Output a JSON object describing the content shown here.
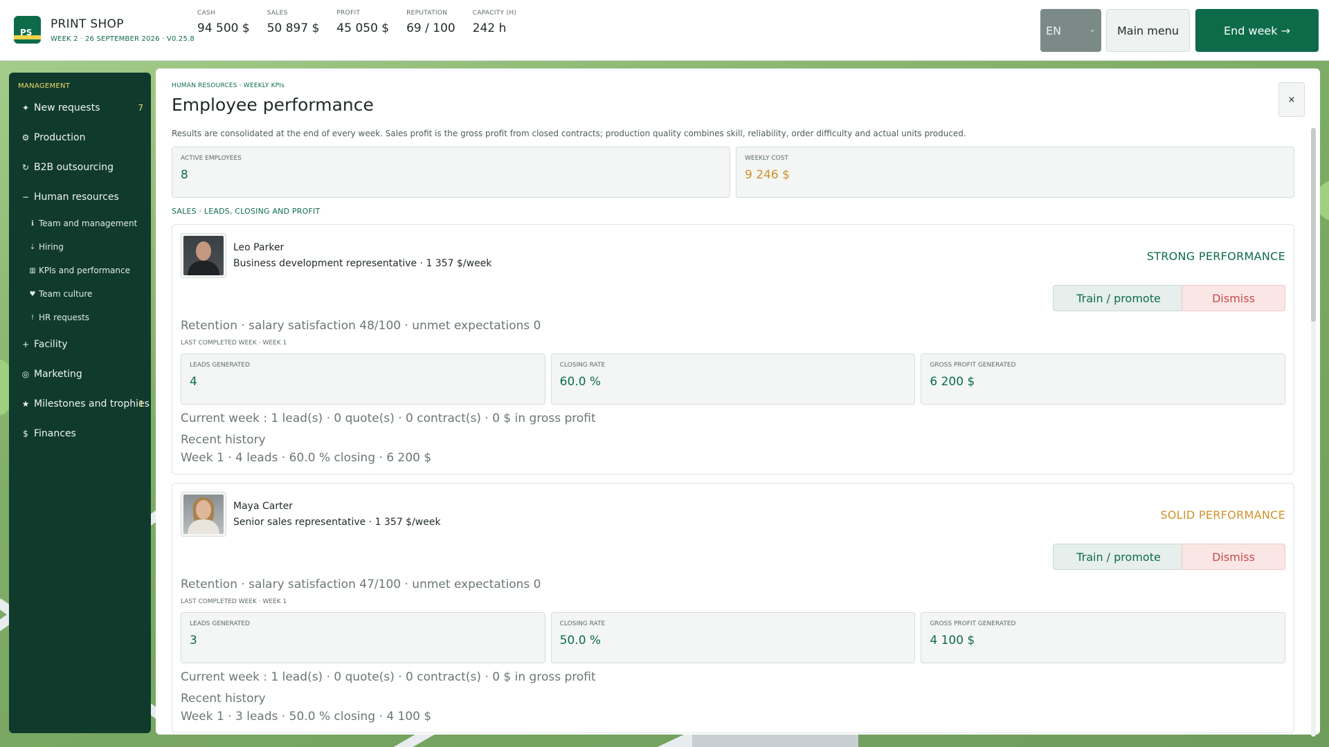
{
  "app": {
    "logo_text": "PS",
    "name": "PRINT SHOP",
    "subtitle": "WEEK 2 · 26 SEPTEMBER 2026 · V0.25.8"
  },
  "stats": [
    {
      "label": "CASH",
      "value": "94 500 $"
    },
    {
      "label": "SALES",
      "value": "50 897 $"
    },
    {
      "label": "PROFIT",
      "value": "45 050 $"
    },
    {
      "label": "REPUTATION",
      "value": "69 / 100"
    },
    {
      "label": "CAPACITY (H)",
      "value": "242 h"
    }
  ],
  "header_buttons": {
    "language": "EN",
    "main_menu": "Main menu",
    "end_week": "End week →"
  },
  "sidebar": {
    "section": "MANAGEMENT",
    "items": [
      {
        "icon": "✦",
        "label": "New requests",
        "badge": "7"
      },
      {
        "icon": "⚙",
        "label": "Production",
        "badge": ""
      },
      {
        "icon": "↻",
        "label": "B2B outsourcing",
        "badge": ""
      },
      {
        "icon": "−",
        "label": "Human resources",
        "badge": ""
      }
    ],
    "subitems": [
      {
        "icon": "ℹ",
        "label": "Team and management"
      },
      {
        "icon": "⇣",
        "label": "Hiring"
      },
      {
        "icon": "▥",
        "label": "KPIs and performance"
      },
      {
        "icon": "♥",
        "label": "Team culture"
      },
      {
        "icon": "!",
        "label": "HR requests"
      }
    ],
    "items_after": [
      {
        "icon": "+",
        "label": "Facility",
        "badge": ""
      },
      {
        "icon": "◎",
        "label": "Marketing",
        "badge": ""
      },
      {
        "icon": "★",
        "label": "Milestones and trophies",
        "badge": "1"
      },
      {
        "icon": "$",
        "label": "Finances",
        "badge": ""
      }
    ]
  },
  "panel": {
    "breadcrumb": "HUMAN RESOURCES · WEEKLY KPIs",
    "title": "Employee performance",
    "close": "×",
    "description": "Results are consolidated at the end of every week. Sales profit is the gross profit from closed contracts; production quality combines skill, reliability, order difficulty and actual units produced.",
    "summary": [
      {
        "label": "ACTIVE EMPLOYEES",
        "value": "8"
      },
      {
        "label": "WEEKLY COST",
        "value": "9 246 $"
      }
    ],
    "section_title": "SALES · LEADS, CLOSING AND PROFIT"
  },
  "employees": [
    {
      "name": "Leo Parker",
      "role": "Business development representative · 1 357 $/week",
      "performance": "STRONG PERFORMANCE",
      "train_label": "Train / promote",
      "dismiss_label": "Dismiss",
      "retention": "Retention · salary satisfaction 48/100 · unmet expectations 0",
      "last_week": "LAST COMPLETED WEEK · WEEK 1",
      "metrics": [
        {
          "label": "LEADS GENERATED",
          "value": "4"
        },
        {
          "label": "CLOSING RATE",
          "value": "60.0 %"
        },
        {
          "label": "GROSS PROFIT GENERATED",
          "value": "6 200 $"
        }
      ],
      "current_week": "Current week : 1 lead(s) · 0 quote(s) · 0 contract(s) · 0 $ in gross profit",
      "history_title": "Recent history",
      "history": "Week 1 · 4 leads · 60.0 % closing · 6 200 $"
    },
    {
      "name": "Maya Carter",
      "role": "Senior sales representative · 1 357 $/week",
      "performance": "SOLID PERFORMANCE",
      "train_label": "Train / promote",
      "dismiss_label": "Dismiss",
      "retention": "Retention · salary satisfaction 47/100 · unmet expectations 0",
      "last_week": "LAST COMPLETED WEEK · WEEK 1",
      "metrics": [
        {
          "label": "LEADS GENERATED",
          "value": "3"
        },
        {
          "label": "CLOSING RATE",
          "value": "50.0 %"
        },
        {
          "label": "GROSS PROFIT GENERATED",
          "value": "4 100 $"
        }
      ],
      "current_week": "Current week : 1 lead(s) · 0 quote(s) · 0 contract(s) · 0 $ in gross profit",
      "history_title": "Recent history",
      "history": "Week 1 · 3 leads · 50.0 % closing · 4 100 $"
    }
  ],
  "colors": {
    "brand": "#0d6b4a",
    "sidebar": "#0f3a2c",
    "accent_yellow": "#f1de6a",
    "warning_orange": "#d2902a",
    "danger": "#c64b4b"
  }
}
